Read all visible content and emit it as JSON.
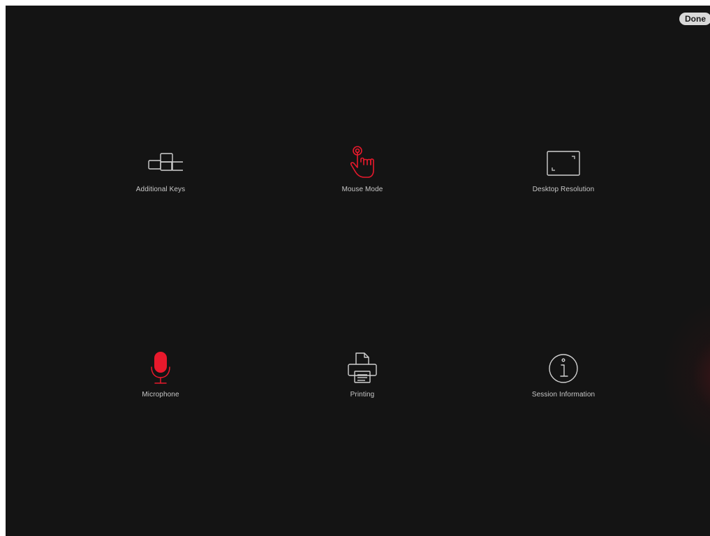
{
  "header": {
    "done_label": "Done"
  },
  "menu": {
    "items": [
      {
        "label": "Additional Keys",
        "icon": "keyboard-keys-icon",
        "active": false
      },
      {
        "label": "Mouse Mode",
        "icon": "touch-hand-icon",
        "active": true
      },
      {
        "label": "Desktop Resolution",
        "icon": "resolution-frame-icon",
        "active": false
      },
      {
        "label": "Microphone",
        "icon": "microphone-icon",
        "active": true
      },
      {
        "label": "Printing",
        "icon": "printer-icon",
        "active": false
      },
      {
        "label": "Session Information",
        "icon": "info-icon",
        "active": false
      }
    ]
  },
  "colors": {
    "background": "#141414",
    "icon_default": "#d0d0d0",
    "accent_active": "#e8192c",
    "label": "#c8c8c8",
    "done_button_bg": "#d9d9d9"
  }
}
